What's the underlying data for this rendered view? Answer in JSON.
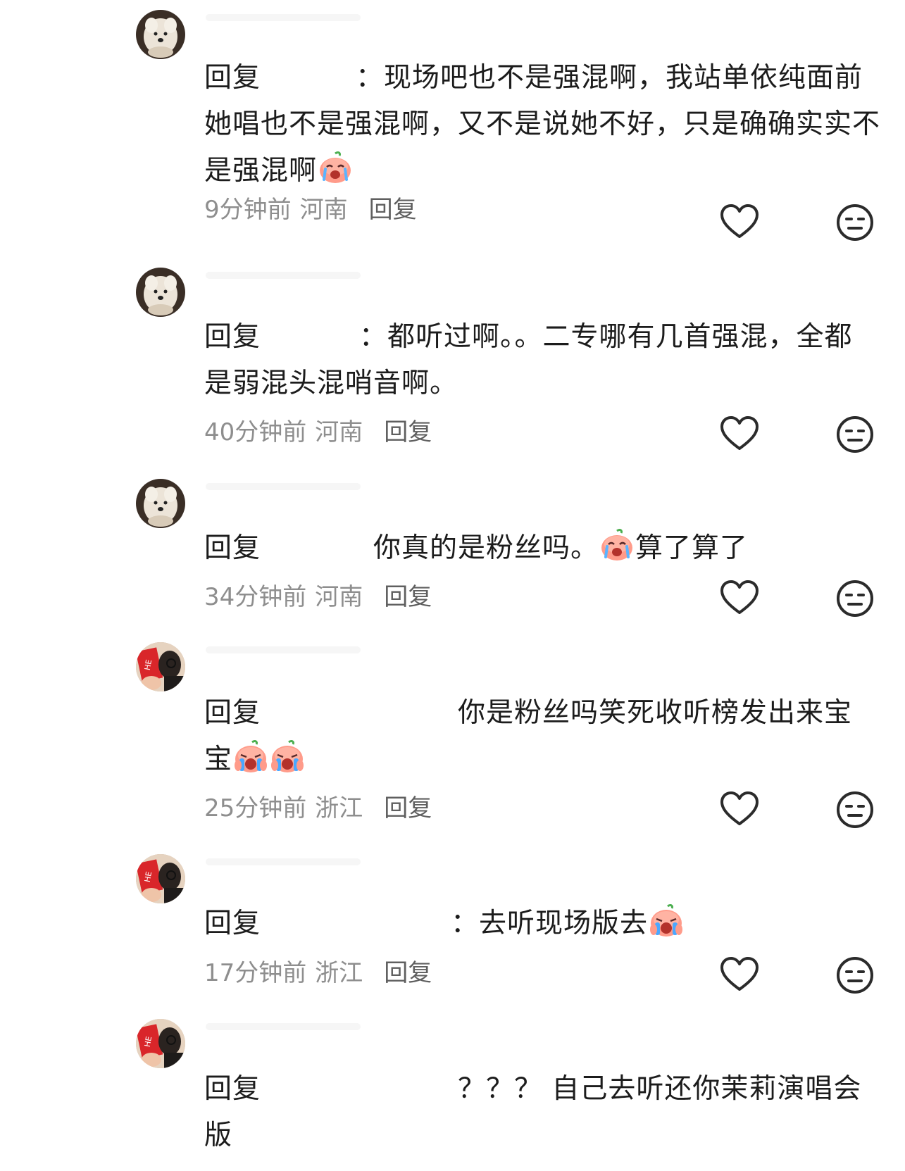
{
  "comments": [
    {
      "reply_word": "回复",
      "text": "：现场吧也不是强混啊，我站单依纯面前她唱也不是强混啊，又不是说她不好，只是确确实实不是强混啊",
      "emojis": [
        "crying-face-emoji"
      ],
      "time": "9分钟前",
      "location": "河南",
      "reply_label": "回复",
      "avatar": "puppy-avatar"
    },
    {
      "reply_word": "回复",
      "text": "：都听过啊。。二专哪有几首强混，全都是弱混头混哨音啊。",
      "emojis": [],
      "time": "40分钟前",
      "location": "河南",
      "reply_label": "回复",
      "avatar": "puppy-avatar"
    },
    {
      "reply_word": "回复",
      "text_before": "你真的是粉丝吗。",
      "text_after": "算了算了",
      "emojis": [
        "crying-face-emoji"
      ],
      "time": "34分钟前",
      "location": "河南",
      "reply_label": "回复",
      "avatar": "puppy-avatar"
    },
    {
      "reply_word": "回复",
      "text": "你是粉丝吗笑死收听榜发出来宝宝",
      "emojis": [
        "sobbing-face-emoji",
        "sobbing-face-emoji"
      ],
      "time": "25分钟前",
      "location": "浙江",
      "reply_label": "回复",
      "avatar": "red-card-avatar"
    },
    {
      "reply_word": "回复",
      "text": "：去听现场版去",
      "emojis": [
        "sobbing-face-emoji"
      ],
      "time": "17分钟前",
      "location": "浙江",
      "reply_label": "回复",
      "avatar": "red-card-avatar"
    },
    {
      "reply_word": "回复",
      "text": "？？？ 自己去听还你茉莉演唱会版",
      "emojis": [],
      "time": "",
      "location": "",
      "reply_label": "",
      "avatar": "red-card-avatar"
    }
  ],
  "icons": {
    "like": "heart-outline-icon",
    "dislike": "meh-face-icon"
  },
  "colors": {
    "text": "#1c1c1c",
    "meta": "#8e8e8e",
    "icon_stroke": "#2b2b2b"
  }
}
